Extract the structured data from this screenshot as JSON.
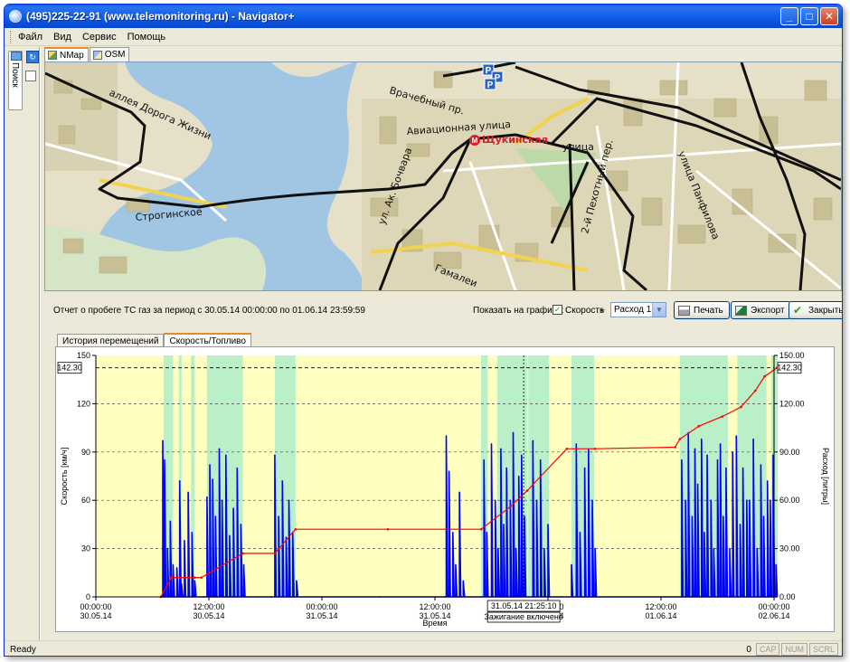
{
  "window": {
    "title": "(495)225-22-91  (www.telemonitoring.ru) - Navigator+",
    "btn_min": "_",
    "btn_max": "□",
    "btn_close": "✕"
  },
  "menu": [
    "Файл",
    "Вид",
    "Сервис",
    "Помощь"
  ],
  "left_rail": {
    "search_tab": "Поиск"
  },
  "map_tabs": [
    "NMap",
    "OSM"
  ],
  "map": {
    "station": "Щукинская",
    "parking_marker": "P",
    "metro_marker": "М",
    "streets": {
      "doroga_zhizni": "аллея Дорога Жизни",
      "vrachebny": "Врачебный пр.",
      "aviacionnaya": "Авиационная улица",
      "ulitsa": "улица",
      "stroginskoe": "Строгинское",
      "boytsova": "ул. Ак. Бочвара",
      "gamaleyi": "Гамалеи",
      "pekhotny": "2-й Пехотный пер.",
      "panfilova": "улица Панфилова"
    }
  },
  "report": {
    "title": "Отчет о пробеге ТС  газ за период с 30.05.14 00:00:00 по 01.06.14 23:59:59",
    "show_label": "Показать на графике:",
    "speed_label": "Скорость",
    "plus": "+",
    "fuel_select": "Расход 1",
    "print_btn": "Печать",
    "export_btn": "Экспорт",
    "close_btn": "Закрыть"
  },
  "bottom_tabs": [
    "История перемещений",
    "Скорость/Топливо"
  ],
  "chart_data": {
    "type": "line",
    "xlabel": "Время",
    "ylabel": "Скорость [км/ч]",
    "y2label": "Расход [литры]",
    "ylim": [
      0,
      150
    ],
    "y2lim": [
      0,
      150
    ],
    "yticks": [
      "0",
      "30",
      "60",
      "90",
      "120",
      "150"
    ],
    "y2ticks": [
      "0.00",
      "30.00",
      "60.00",
      "90.00",
      "120.00",
      "150.00"
    ],
    "xticks": [
      {
        "time": "00:00:00",
        "date": "30.05.14",
        "hour": 0
      },
      {
        "time": "12:00:00",
        "date": "30.05.14",
        "hour": 12
      },
      {
        "time": "00:00:00",
        "date": "31.05.14",
        "hour": 24
      },
      {
        "time": "12:00:00",
        "date": "31.05.14",
        "hour": 36
      },
      {
        "time": "00:00:00",
        "date": "01.06.14",
        "hour": 48
      },
      {
        "time": "12:00:00",
        "date": "01.06.14",
        "hour": 60
      },
      {
        "time": "00:00:00",
        "date": "02.06.14",
        "hour": 72
      }
    ],
    "xlim_hours": [
      0,
      72
    ],
    "max_fuel_label": "142.30",
    "max_fuel_value": 142.3,
    "cursor": {
      "label": "31.05.14 21:25:10",
      "sublabel": "Зажигание включено",
      "hour": 45.42
    },
    "ignition_on_ranges_hours": [
      [
        7.2,
        8.2
      ],
      [
        8.8,
        9.1
      ],
      [
        10.1,
        10.5
      ],
      [
        11.8,
        15.6
      ],
      [
        19.0,
        21.2
      ],
      [
        40.9,
        41.6
      ],
      [
        42.6,
        45.8
      ],
      [
        45.9,
        48.1
      ],
      [
        50.5,
        52.9
      ],
      [
        62.0,
        67.1
      ],
      [
        68.1,
        71.2
      ],
      [
        71.7,
        72.4
      ]
    ],
    "speed_series": {
      "name": "Скорость",
      "x_hours": [
        6.9,
        7.1,
        7.3,
        7.6,
        7.9,
        8.2,
        8.6,
        8.9,
        9.1,
        9.4,
        9.8,
        10.2,
        10.5,
        11.5,
        11.8,
        12.1,
        12.4,
        12.7,
        13.1,
        13.4,
        13.8,
        14.2,
        14.6,
        15.0,
        15.4,
        15.7,
        18.6,
        19.0,
        19.4,
        19.8,
        20.2,
        20.5,
        20.9,
        21.3,
        30.1,
        37.0,
        37.2,
        37.5,
        37.9,
        38.2,
        38.6,
        39.0,
        40.9,
        41.2,
        41.5,
        42.0,
        42.4,
        42.7,
        43.0,
        43.3,
        43.6,
        44.0,
        44.3,
        44.6,
        44.9,
        45.2,
        45.5,
        46.4,
        46.8,
        47.2,
        47.6,
        48.0,
        50.5,
        51.0,
        51.4,
        51.9,
        52.3,
        52.7,
        53.0,
        62.2,
        62.6,
        62.9,
        63.3,
        63.6,
        63.9,
        64.3,
        64.6,
        64.9,
        65.3,
        65.6,
        66.0,
        66.3,
        66.6,
        66.9,
        67.3,
        67.6,
        68.0,
        68.4,
        68.7,
        69.1,
        69.4,
        69.8,
        70.2,
        70.6,
        70.9,
        71.3,
        71.6,
        71.9,
        72.2
      ],
      "y": [
        0,
        97,
        85,
        30,
        47,
        20,
        18,
        72,
        8,
        35,
        65,
        40,
        10,
        0,
        62,
        82,
        73,
        50,
        92,
        60,
        88,
        38,
        55,
        80,
        45,
        20,
        0,
        88,
        50,
        72,
        37,
        60,
        40,
        10,
        0,
        0,
        100,
        78,
        40,
        20,
        65,
        10,
        0,
        85,
        40,
        95,
        60,
        30,
        92,
        45,
        80,
        60,
        102,
        30,
        75,
        88,
        50,
        97,
        60,
        85,
        30,
        45,
        20,
        95,
        40,
        80,
        92,
        60,
        30,
        85,
        60,
        102,
        50,
        92,
        70,
        98,
        40,
        88,
        60,
        30,
        85,
        95,
        50,
        80,
        30,
        90,
        100,
        45,
        80,
        60,
        60,
        98,
        30,
        82,
        50,
        72,
        60,
        88,
        20
      ]
    },
    "fuel_series": {
      "name": "Расход 1",
      "x_hours": [
        6.9,
        8.0,
        10.5,
        11.2,
        15.6,
        19.0,
        21.2,
        31.0,
        40.9,
        44.0,
        45.8,
        50.0,
        51.0,
        53.0,
        61.5,
        62.0,
        64.0,
        66.5,
        68.5,
        70.0,
        71.0,
        72.3
      ],
      "y": [
        0,
        12,
        12,
        12,
        27,
        27,
        42,
        42,
        42,
        56,
        66,
        92,
        92,
        92,
        93,
        98,
        106,
        112,
        118,
        128,
        137,
        142.3
      ]
    }
  },
  "status": {
    "ready": "Ready",
    "counter": "0",
    "caps": "CAP",
    "num": "NUM",
    "scrl": "SCRL"
  },
  "colors": {
    "ignition": "#b9f0c8",
    "plot_bg": "#ffffc0",
    "speed": "#0000ff",
    "fuel": "#ff0000"
  }
}
